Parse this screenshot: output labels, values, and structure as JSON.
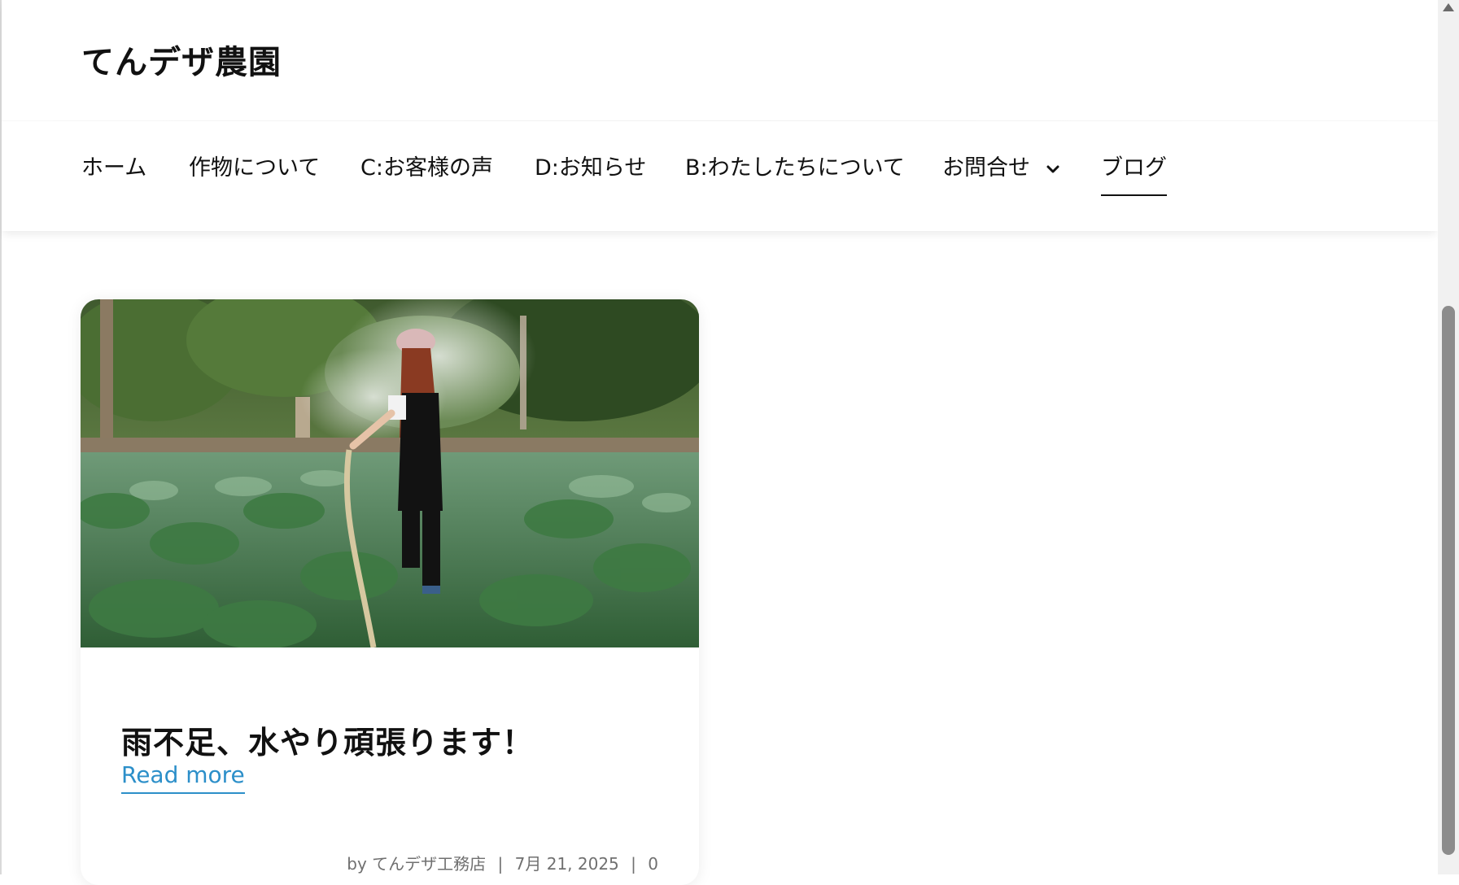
{
  "site": {
    "title": "てんデザ農園"
  },
  "nav": {
    "items": [
      {
        "label": "ホーム"
      },
      {
        "label": "作物について"
      },
      {
        "label": "C:お客様の声"
      },
      {
        "label": "D:お知らせ"
      },
      {
        "label": "B:わたしたちについて"
      },
      {
        "label": "お問合せ",
        "icon": "chevron-down-icon"
      },
      {
        "label": "ブログ",
        "active": true
      }
    ]
  },
  "post": {
    "image_alt": "woman watering vegetable field with hose",
    "title": "雨不足、水やり頑張ります！",
    "read_more": "Read more",
    "meta": {
      "by": "by",
      "author": "てんデザ工務店",
      "separator": "|",
      "date": "7月 21, 2025",
      "comments": "0"
    }
  },
  "colors": {
    "link": "#2c8fc9",
    "text": "#111111",
    "meta": "#707070"
  }
}
